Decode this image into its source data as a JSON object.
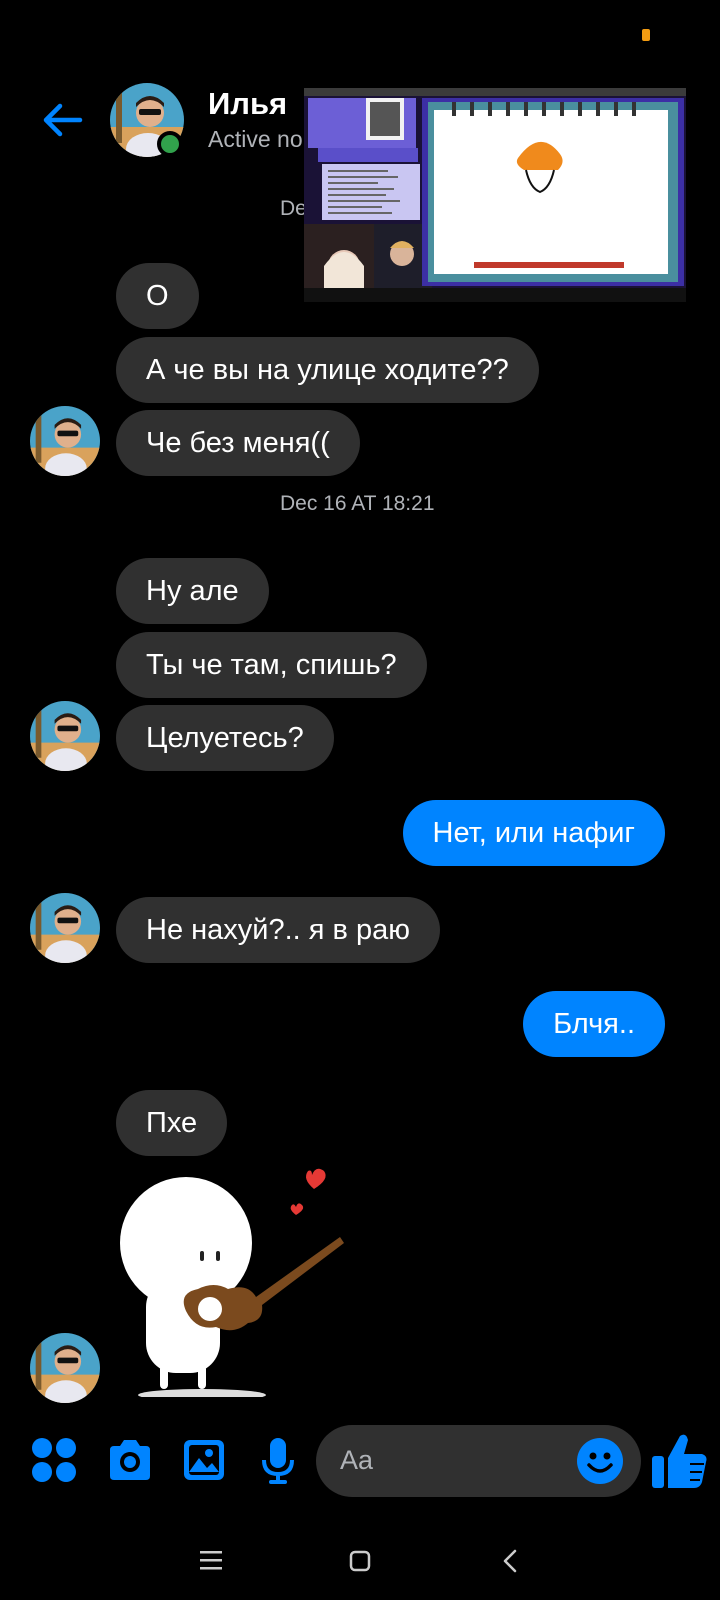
{
  "header": {
    "contact_name": "Илья",
    "status_text": "Active no"
  },
  "timestamps": {
    "first": "De",
    "second": "Dec 16 AT 18:21"
  },
  "messages": [
    {
      "side": "in",
      "text": "О"
    },
    {
      "side": "in",
      "text": "А че вы на улице ходите??"
    },
    {
      "side": "in",
      "text": "Че без меня(("
    },
    {
      "side": "in",
      "text": "Ну але"
    },
    {
      "side": "in",
      "text": "Ты че там, спишь?"
    },
    {
      "side": "in",
      "text": "Целуетесь?"
    },
    {
      "side": "out",
      "text": "Нет, или нафиг"
    },
    {
      "side": "in",
      "text": "Не нахуй?.. я в раю"
    },
    {
      "side": "out",
      "text": "Блчя.."
    },
    {
      "side": "in",
      "text": "Пхе"
    }
  ],
  "sticker": {
    "icon": "violin-character-sticker"
  },
  "composer": {
    "placeholder": "Aa"
  },
  "toolbar_icons": [
    "apps-icon",
    "camera-icon",
    "gallery-icon",
    "mic-icon",
    "emoji-icon",
    "like-icon"
  ],
  "colors": {
    "accent": "#0084ff",
    "incoming": "#303030",
    "online": "#31a24c"
  }
}
